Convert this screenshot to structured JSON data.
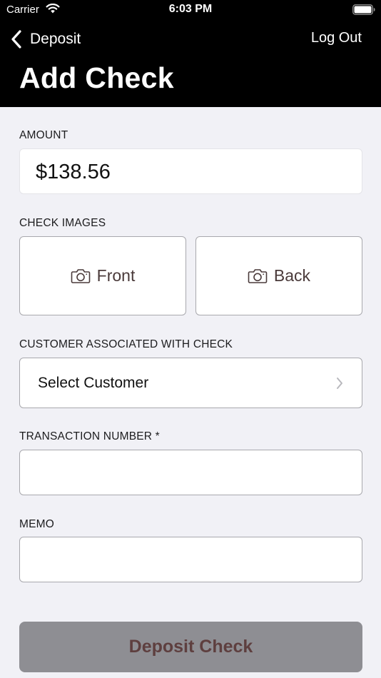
{
  "status_bar": {
    "carrier": "Carrier",
    "time": "6:03 PM"
  },
  "nav": {
    "back_label": "Deposit",
    "logout_label": "Log Out",
    "title": "Add Check"
  },
  "amount": {
    "label": "AMOUNT",
    "value": "$138.56"
  },
  "check_images": {
    "label": "CHECK IMAGES",
    "front_label": "Front",
    "back_label": "Back"
  },
  "customer": {
    "label": "CUSTOMER ASSOCIATED WITH CHECK",
    "value": "Select Customer"
  },
  "transaction_number": {
    "label": "TRANSACTION NUMBER *",
    "value": ""
  },
  "memo": {
    "label": "MEMO",
    "value": ""
  },
  "deposit_button": {
    "label": "Deposit Check"
  },
  "colors": {
    "header_bg": "#000000",
    "page_bg": "#f1f1f6",
    "button_disabled_bg": "#8e8e93",
    "button_disabled_text": "#5e3f3f",
    "accent_text": "#4a3a3a"
  }
}
